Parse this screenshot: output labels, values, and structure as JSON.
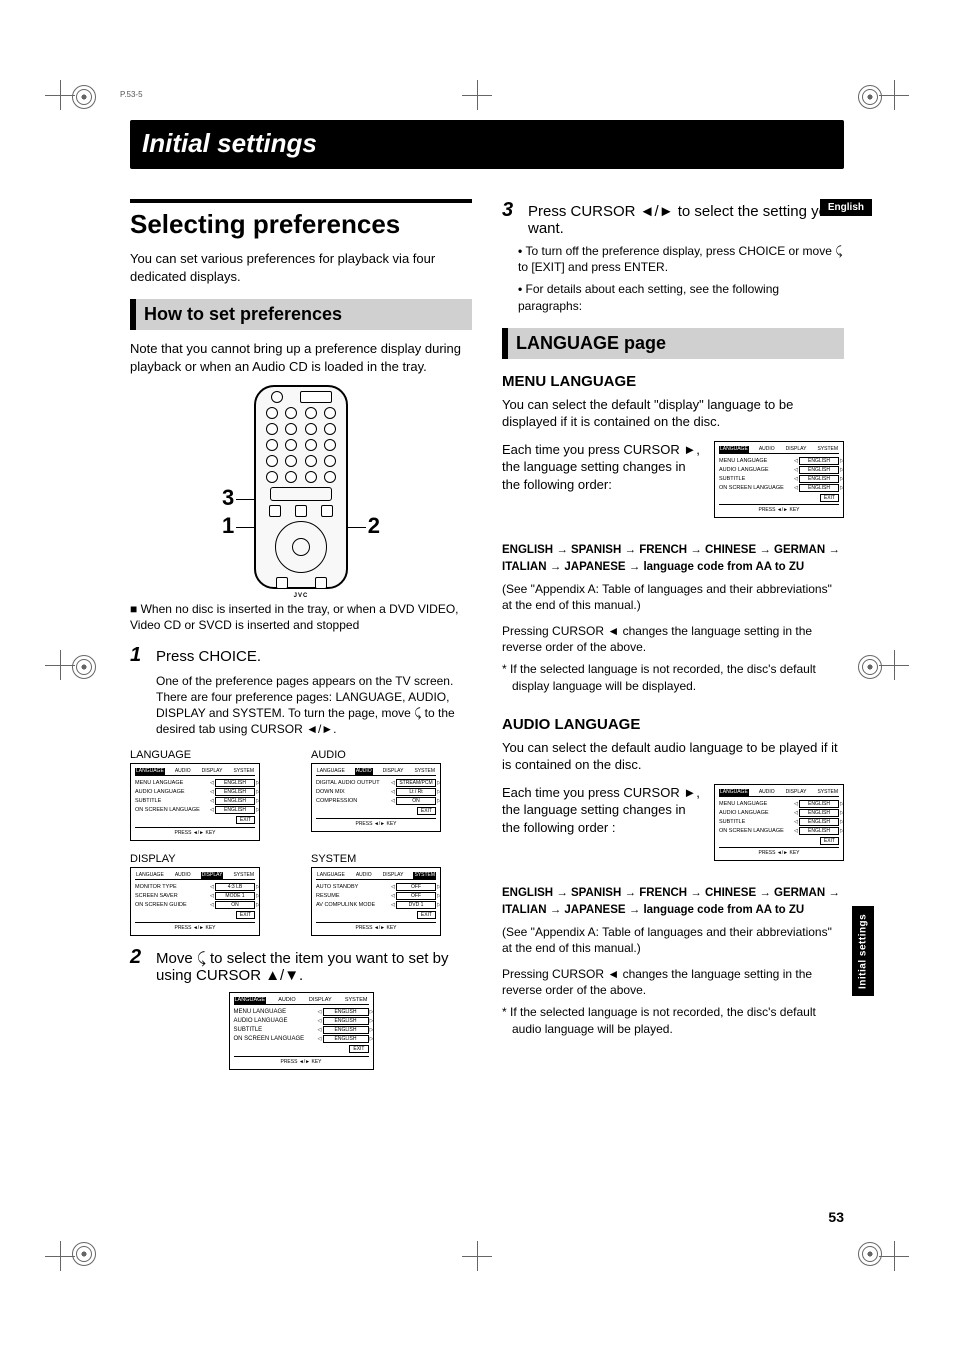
{
  "tiny_header": "P.53-5",
  "header": "Initial settings",
  "side_tab": "Initial settings",
  "lang_badge": "English",
  "page_number": "53",
  "left": {
    "h1": "Selecting preferences",
    "intro": "You can set various preferences for playback via four dedicated displays.",
    "sub1": "How to set preferences",
    "sub1_note": "Note that you cannot bring up a preference display during playback or when an Audio CD is loaded in the tray.",
    "remote_logo": "JVC",
    "callout1": "1",
    "callout2": "2",
    "callout3": "3",
    "bullet1": "When no disc is inserted in the tray, or when a DVD VIDEO, Video CD or SVCD is inserted and stopped",
    "step1_num": "1",
    "step1_txt": "Press CHOICE.",
    "step1_sub": "One of the preference pages appears on the TV screen. There are four preference pages: LANGUAGE, AUDIO, DISPLAY and SYSTEM. To turn the page, move ⤹ to the desired tab using CURSOR ◄/►.",
    "mini": {
      "lang_label": "LANGUAGE",
      "audio_label": "AUDIO",
      "display_label": "DISPLAY",
      "system_label": "SYSTEM"
    },
    "step2_num": "2",
    "step2_txt": "Move ⤹ to select the item you want to set by using CURSOR ▲/▼."
  },
  "right": {
    "step3_num": "3",
    "step3_txt": "Press CURSOR ◄/► to select the setting you want.",
    "step3_b1": "To turn off the preference display, press CHOICE or move ⤹ to [EXIT] and press ENTER.",
    "step3_b2": "For details about each setting, see the following paragraphs:",
    "sub2": "LANGUAGE page",
    "h2a": "MENU LANGUAGE",
    "h2a_p": "You can select the default \"display\" language to be displayed if it is contained on the disc.",
    "h2a_p2": "Each time you press CURSOR ►, the language setting changes in the following order:",
    "langseq_a": "ENGLISH",
    "langseq_b": "SPANISH",
    "langseq_c": "FRENCH",
    "langseq_d": "CHINESE",
    "langseq_e": "GERMAN",
    "langseq_f": "ITALIAN",
    "langseq_g": "JAPANESE",
    "langseq_h": "language code from AA to ZU",
    "appendix": "(See \"Appendix A: Table of languages and their abbreviations\" at the end of this manual.)",
    "reverse": "Pressing CURSOR ◄ changes the language setting in the reverse order of the above.",
    "ast1": "*  If the selected language is not recorded, the disc's default display language will be displayed.",
    "h2b": "AUDIO LANGUAGE",
    "h2b_p": "You can select the default audio language to be played if it is contained on the disc.",
    "h2b_p2": "Each time you press CURSOR ►, the language setting changes in the following order :",
    "ast2": "*  If the selected language is not recorded, the disc's default audio language will be played."
  },
  "osd": {
    "tabs": {
      "language": "LANGUAGE",
      "audio": "AUDIO",
      "display": "DISPLAY",
      "system": "SYSTEM"
    },
    "lang_rows": [
      {
        "lab": "MENU LANGUAGE",
        "val": "ENGLISH"
      },
      {
        "lab": "AUDIO LANGUAGE",
        "val": "ENGLISH"
      },
      {
        "lab": "SUBTITLE",
        "val": "ENGLISH"
      },
      {
        "lab": "ON SCREEN LANGUAGE",
        "val": "ENGLISH"
      }
    ],
    "audio_rows": [
      {
        "lab": "DIGITAL AUDIO OUTPUT",
        "val": "STREAM/PCM"
      },
      {
        "lab": "DOWN MIX",
        "val": "Lt / Rt"
      },
      {
        "lab": "COMPRESSION",
        "val": "ON"
      }
    ],
    "display_rows": [
      {
        "lab": "MONITOR TYPE",
        "val": "4:3 LB"
      },
      {
        "lab": "SCREEN SAVER",
        "val": "MODE 1"
      },
      {
        "lab": "ON SCREEN GUIDE",
        "val": "ON"
      }
    ],
    "system_rows": [
      {
        "lab": "AUTO STANDBY",
        "val": "OFF"
      },
      {
        "lab": "RESUME",
        "val": "OFF"
      },
      {
        "lab": "AV COMPULINK MODE",
        "val": "DVD 1"
      }
    ],
    "exit": "EXIT",
    "foot": "PRESS ◄/► KEY"
  }
}
